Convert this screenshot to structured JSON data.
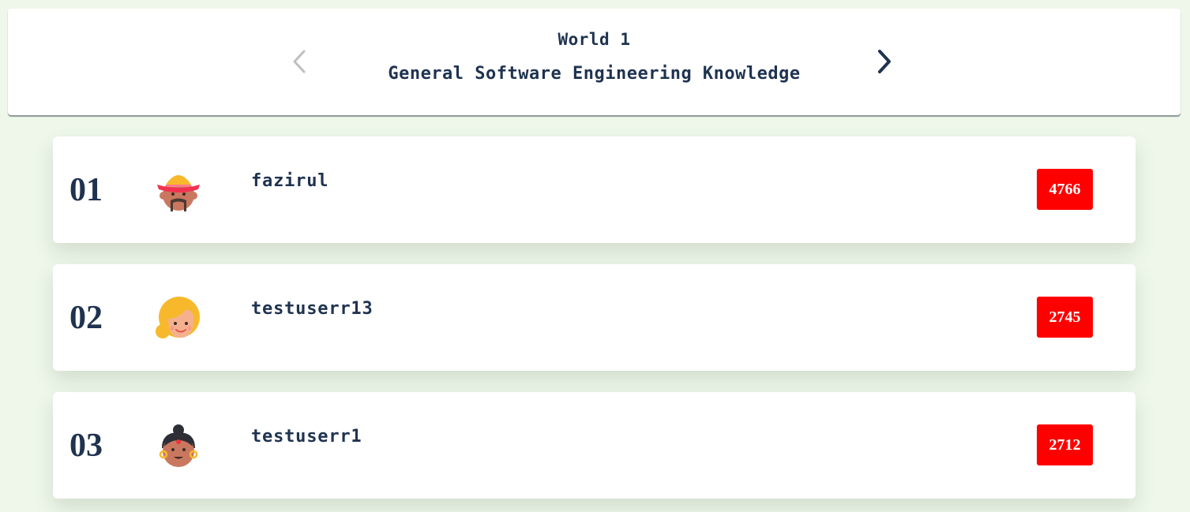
{
  "header": {
    "world_title": "World 1",
    "world_subtitle": "General Software Engineering Knowledge",
    "prev_icon": "chevron-left-icon",
    "next_icon": "chevron-right-icon",
    "prev_disabled": true
  },
  "leaderboard": [
    {
      "rank": "01",
      "username": "fazirul",
      "score": "4766",
      "avatar": "sombrero-man-avatar"
    },
    {
      "rank": "02",
      "username": "testuserr13",
      "score": "2745",
      "avatar": "blonde-woman-avatar"
    },
    {
      "rank": "03",
      "username": "testuserr1",
      "score": "2712",
      "avatar": "bindi-woman-avatar"
    }
  ],
  "colors": {
    "background": "#eef7ea",
    "text": "#1f3350",
    "score_badge": "#ff0000",
    "arrow_disabled": "#bfbfbf"
  }
}
